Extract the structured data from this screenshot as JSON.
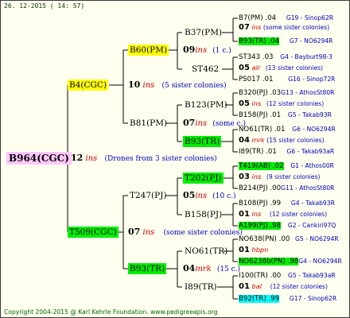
{
  "date": "26. 12-2015 ( 14: 57)",
  "copyright": "Copyright 2004-2015 @ Karl Kehrle Foundation.   www.pedigreeapis.org",
  "root": {
    "name": "B964(CGC)",
    "gen": "12",
    "ins": "ins",
    "note": "(Drones from 3 sister colonies)"
  },
  "upper": {
    "name": "B4(CGC)",
    "gen": "10",
    "ins": "ins",
    "note": "(5 sister colonies)"
  },
  "lower": {
    "name": "T509(CGC)",
    "gen": "07",
    "ins": "ins",
    "note": "(some sister colonies)"
  },
  "b60": {
    "name": "B60(PM)",
    "gen": "09",
    "ins": "ins",
    "note": "(1 c.)"
  },
  "b81": {
    "name": "B81(PM)",
    "gen": "07",
    "ins": "ins",
    "note": "(some c.)"
  },
  "t247": {
    "name": "T247(PJ)",
    "gen": "05",
    "ins": "ins",
    "note": "(10 c.)"
  },
  "b93": {
    "name": "B93(TR)",
    "gen": "04",
    "ins": "mrk",
    "note": "(15 c.)"
  },
  "b37": {
    "name": "B37(PM)"
  },
  "st462": {
    "name": "ST462"
  },
  "b123": {
    "name": "B123(PM)"
  },
  "b93tr": {
    "name": "B93(TR)"
  },
  "t202": {
    "name": "T202(PJ)"
  },
  "b158": {
    "name": "B158(PJ)"
  },
  "no61": {
    "name": "NO61(TR)"
  },
  "i89": {
    "name": "I89(TR)"
  },
  "leaves": {
    "l1": {
      "a": "B7(PM) .04",
      "b": "G19 - Sinop62R"
    },
    "l2": {
      "gen": "07",
      "ins": "ins",
      "note": "(some sister colonies)"
    },
    "l3": {
      "a": "B93(TR) .04",
      "b": "G7 - NO6294R"
    },
    "l4": {
      "a": "ST343 .03",
      "b": "G4 - Bayburt98-3"
    },
    "l5": {
      "gen": "05",
      "ins": "alr",
      "note": "(13 sister colonies)"
    },
    "l6": {
      "a": "PS017 .01",
      "b": "G16 - Sinop72R"
    },
    "l7": {
      "a": "B320(PJ) .03",
      "b": "G13 - AthosSt80R"
    },
    "l8": {
      "gen": "05",
      "ins": "ins",
      "note": "(12 sister colonies)"
    },
    "l9": {
      "a": "B158(PJ) .01",
      "b": "G5 - Takab93R"
    },
    "l10": {
      "a": "NO61(TR) .01",
      "b": "G6 - NO6294R"
    },
    "l11": {
      "gen": "04",
      "ins": "mrk",
      "note": "(15 sister colonies)"
    },
    "l12": {
      "a": "I89(TR) .01",
      "b": "G6 - Takab93aR"
    },
    "l13": {
      "a": "T419(AB) .02",
      "b": "G1 - Athos00R"
    },
    "l14": {
      "gen": "03",
      "ins": "ins",
      "note": "(9 sister colonies)"
    },
    "l15": {
      "a": "B214(PJ) .00",
      "b": "G11 - AthosSt80R"
    },
    "l16": {
      "a": "B108(PJ) .99",
      "b": "G4 - Takab93R"
    },
    "l17": {
      "gen": "01",
      "ins": "ins",
      "note": "(12 sister colonies)"
    },
    "l18": {
      "a": "A199(PJ) .98",
      "b": "G2 - Cankiri97Q"
    },
    "l19": {
      "a": "NO638(PN) .00",
      "b": "G5 - NO6294R"
    },
    "l20": {
      "gen": "01",
      "ins": "hbpn",
      "note": ""
    },
    "l21": {
      "a": "NO6238b(PN) .98",
      "b": "G4 - NO6294R"
    },
    "l22": {
      "a": "I100(TR) .00",
      "b": "G5 - Takab93aR"
    },
    "l23": {
      "gen": "01",
      "ins": "bal",
      "note": "(12 sister colonies)"
    },
    "l24": {
      "a": "B92(TR) .99",
      "b": "G17 - Sinop62R"
    }
  }
}
